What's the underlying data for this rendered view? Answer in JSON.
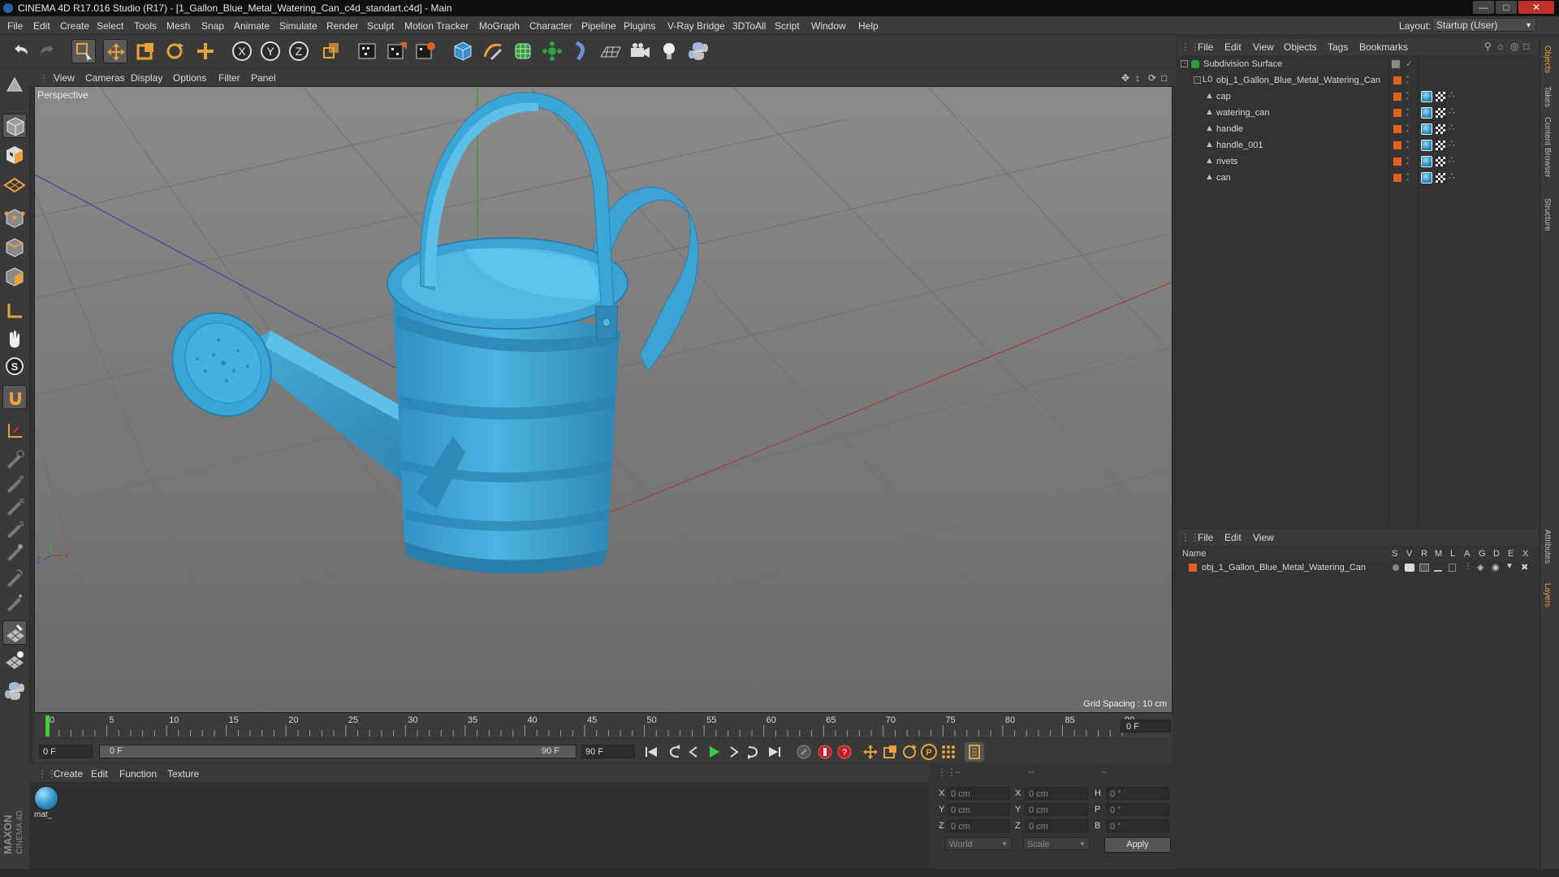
{
  "window": {
    "title": "CINEMA 4D R17.016 Studio (R17) - [1_Gallon_Blue_Metal_Watering_Can_c4d_standart.c4d] - Main",
    "minimize_icon": "minimize-icon",
    "maximize_icon": "maximize-icon",
    "close_icon": "close-icon"
  },
  "menu": [
    "File",
    "Edit",
    "Create",
    "Select",
    "Tools",
    "Mesh",
    "Snap",
    "Animate",
    "Simulate",
    "Render",
    "Sculpt",
    "Motion Tracker",
    "MoGraph",
    "Character",
    "Pipeline",
    "Plugins",
    "V-Ray Bridge",
    "3DToAll",
    "Script",
    "Window",
    "Help"
  ],
  "layout": {
    "label": "Layout:",
    "value": "Startup (User)"
  },
  "toolbar": {
    "icons": [
      "undo-icon",
      "redo-icon",
      "live-selection-icon",
      "move-icon",
      "scale-icon",
      "rotate-icon",
      "move-add-icon",
      "x-axis-icon",
      "y-axis-icon",
      "z-axis-icon",
      "world-coordinates-icon",
      "render-view-icon",
      "render-to-picture-viewer-icon",
      "edit-render-settings-icon",
      "cube-icon",
      "pen-spline-icon",
      "subdivision-surface-icon",
      "array-icon",
      "deformer-icon",
      "floor-icon",
      "camera-icon",
      "light-icon",
      "python-icon"
    ],
    "axis_labels": [
      "X",
      "Y",
      "Z"
    ]
  },
  "left_tools": [
    "make-editable-icon",
    "model-mode-icon",
    "texture-mode-icon",
    "workplane-icon",
    "points-mode-icon",
    "edges-mode-icon",
    "polygons-mode-icon",
    "axis-mode-icon",
    "tweak-icon",
    "snap-icon",
    "magnet-icon",
    "locked-workplane-icon",
    "brush-1-icon",
    "brush-2-icon",
    "brush-3-icon",
    "brush-4-icon",
    "brush-5-icon",
    "brush-6-icon",
    "brush-7-icon",
    "paint-icon",
    "sculpt-icon",
    "python-script-icon"
  ],
  "viewport": {
    "menu": [
      "View",
      "Cameras",
      "Display",
      "Options",
      "Filter",
      "Panel"
    ],
    "label": "Perspective",
    "grid_spacing": "Grid Spacing : 10 cm",
    "nav_icons": [
      "move-view-icon",
      "zoom-view-icon",
      "rotate-view-icon",
      "maximize-view-icon"
    ]
  },
  "timeline": {
    "ticks": [
      "0",
      "5",
      "10",
      "15",
      "20",
      "25",
      "30",
      "35",
      "40",
      "45",
      "50",
      "55",
      "60",
      "65",
      "70",
      "75",
      "80",
      "85",
      "90"
    ],
    "current_frame": "0 F",
    "start_field": "0 F",
    "range_start": "0 F",
    "range_end": "90 F",
    "end_field": "90 F"
  },
  "playback_icons": [
    "go-to-start-icon",
    "previous-key-icon",
    "previous-frame-icon",
    "play-icon",
    "next-frame-icon",
    "next-key-icon",
    "go-to-end-icon",
    "record-keys-icon",
    "autokey-icon",
    "keyframe-selection-icon",
    "move-key-icon",
    "scale-key-icon",
    "rotate-key-icon",
    "param-key-icon",
    "pla-key-icon",
    "timeline-icon"
  ],
  "materials": {
    "menu": [
      "Create",
      "Edit",
      "Function",
      "Texture"
    ],
    "items": [
      {
        "name": "mat_"
      }
    ]
  },
  "coordinates": {
    "header": [
      "--",
      "--",
      "--"
    ],
    "rows": [
      {
        "axis": "X",
        "pos": "0 cm",
        "size_axis": "X",
        "size": "0 cm",
        "rot_axis": "H",
        "rot": "0 °"
      },
      {
        "axis": "Y",
        "pos": "0 cm",
        "size_axis": "Y",
        "size": "0 cm",
        "rot_axis": "P",
        "rot": "0 °"
      },
      {
        "axis": "Z",
        "pos": "0 cm",
        "size_axis": "Z",
        "size": "0 cm",
        "rot_axis": "B",
        "rot": "0 °"
      }
    ],
    "mode": "World",
    "scale_mode": "Scale",
    "apply": "Apply"
  },
  "objects": {
    "menu": [
      "File",
      "Edit",
      "View",
      "Objects",
      "Tags",
      "Bookmarks"
    ],
    "tree": [
      {
        "name": "Subdivision Surface",
        "level": 0,
        "icon": "subdivision-surface-icon"
      },
      {
        "name": "obj_1_Gallon_Blue_Metal_Watering_Can",
        "level": 1,
        "icon": "null-object-icon"
      },
      {
        "name": "cap",
        "level": 2,
        "icon": "polygon-object-icon"
      },
      {
        "name": "watering_can",
        "level": 2,
        "icon": "polygon-object-icon"
      },
      {
        "name": "handle",
        "level": 2,
        "icon": "polygon-object-icon"
      },
      {
        "name": "handle_001",
        "level": 2,
        "icon": "polygon-object-icon"
      },
      {
        "name": "rivets",
        "level": 2,
        "icon": "polygon-object-icon"
      },
      {
        "name": "can",
        "level": 2,
        "icon": "polygon-object-icon"
      }
    ]
  },
  "layers": {
    "menu": [
      "File",
      "Edit",
      "View"
    ],
    "columns": [
      "Name",
      "S",
      "V",
      "R",
      "M",
      "L",
      "A",
      "G",
      "D",
      "E",
      "X"
    ],
    "rows": [
      {
        "name": "obj_1_Gallon_Blue_Metal_Watering_Can"
      }
    ]
  },
  "side_tabs": [
    "Objects",
    "Takes",
    "Content Browser",
    "Structure",
    "Attributes",
    "Layers"
  ],
  "brand": [
    "MAXON",
    "CINEMA 4D"
  ],
  "colors": {
    "accent": "#e8a23a",
    "model": "#3aa6d6",
    "layer": "#e06020"
  }
}
